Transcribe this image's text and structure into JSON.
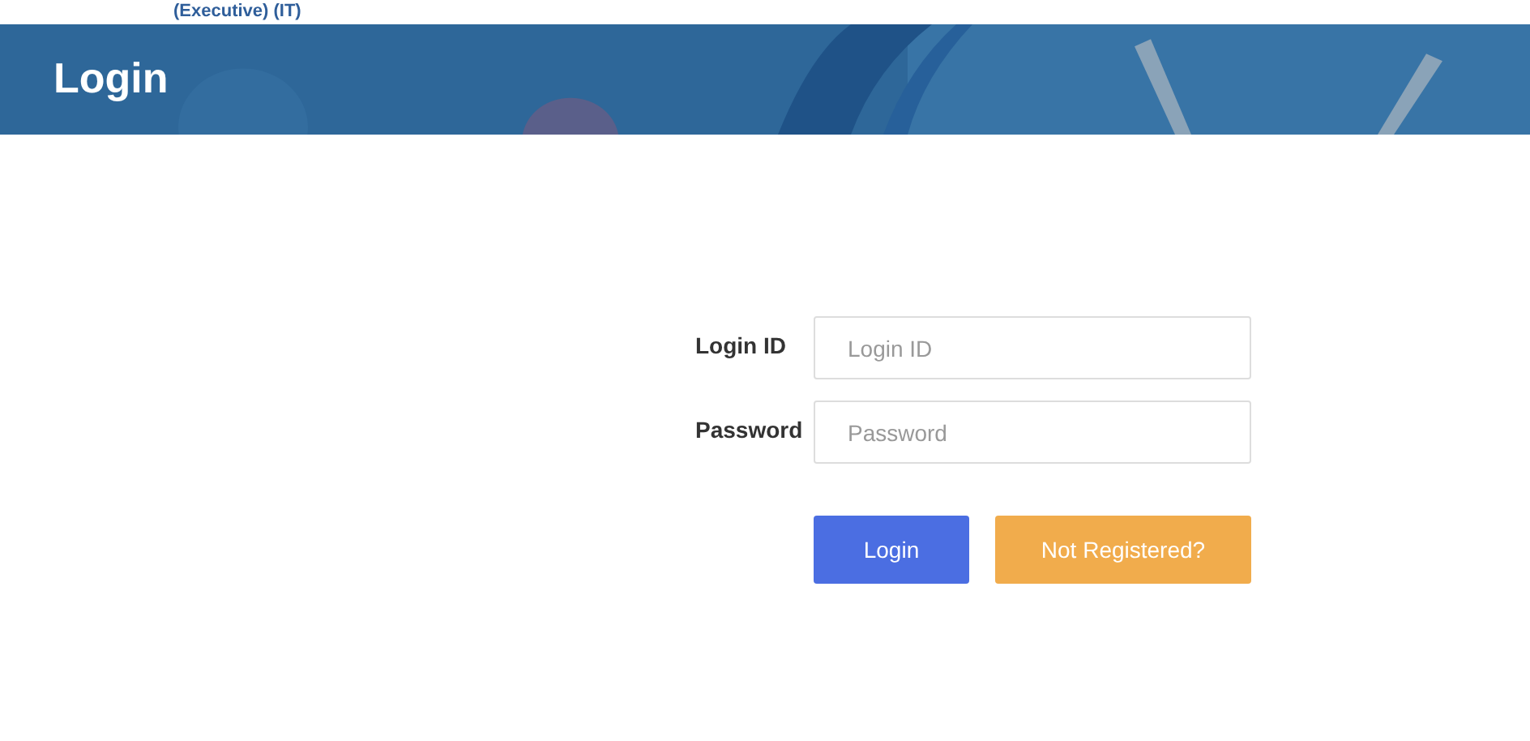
{
  "top_strip": {
    "text": "(Executive) (IT)"
  },
  "header": {
    "title": "Login"
  },
  "form": {
    "fields": [
      {
        "label": "Login ID",
        "placeholder": "Login ID"
      },
      {
        "label": "Password",
        "placeholder": "Password"
      }
    ],
    "buttons": [
      {
        "label": "Login",
        "kind": "primary"
      },
      {
        "label": "Not Registered?",
        "kind": "warning"
      }
    ]
  }
}
